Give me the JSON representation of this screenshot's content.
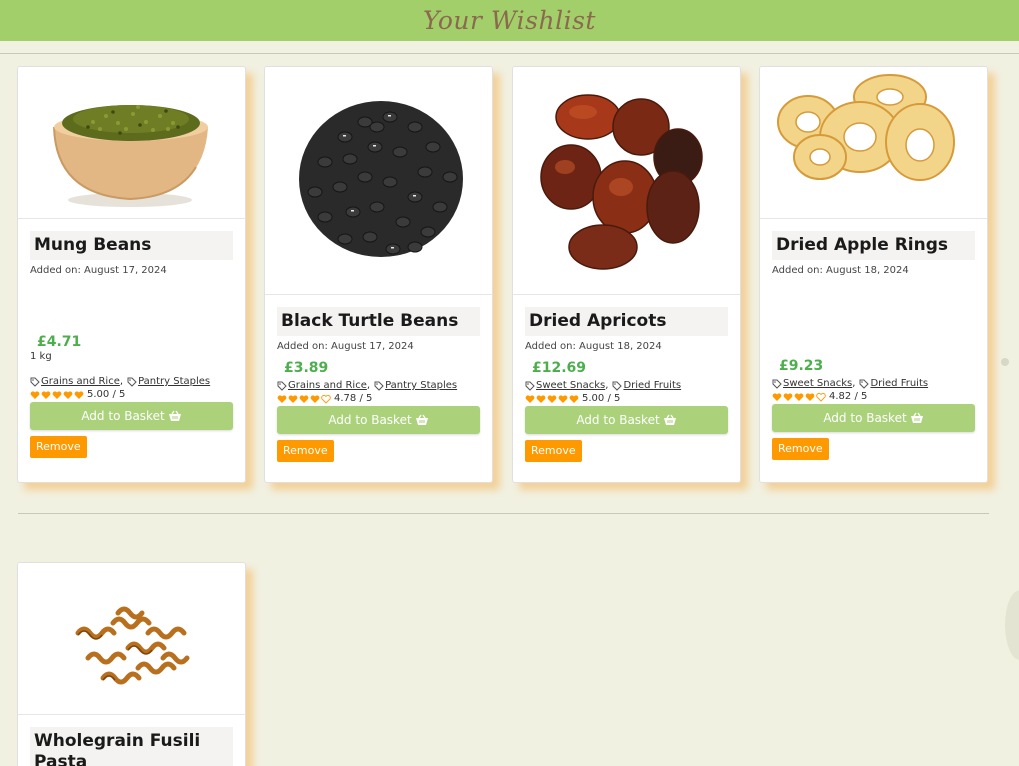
{
  "header": {
    "title": "Your Wishlist"
  },
  "colors": {
    "header_bg": "#a3cf6a",
    "price": "#4caf4c",
    "basket_button": "#abd27b",
    "remove_button": "#ff9900",
    "heart": "#ff9900"
  },
  "products": [
    {
      "name": "Mung Beans",
      "added": "Added on: August 17, 2024",
      "price": "£4.71",
      "unit": "1 kg",
      "tags": [
        "Grains and Rice",
        "Pantry Staples"
      ],
      "tag_separator": ",",
      "rating_value": 5.0,
      "rating_text": "5.00 / 5",
      "basket_label": "Add to Basket",
      "remove_label": "Remove",
      "image": "mung-beans-in-wooden-bowl"
    },
    {
      "name": "Black Turtle Beans",
      "added": "Added on: August 17, 2024",
      "price": "£3.89",
      "unit": "",
      "tags": [
        "Grains and Rice",
        "Pantry Staples"
      ],
      "tag_separator": ",",
      "rating_value": 4.78,
      "rating_text": "4.78 / 5",
      "basket_label": "Add to Basket",
      "remove_label": "Remove",
      "image": "black-beans-pile"
    },
    {
      "name": "Dried Apricots",
      "added": "Added on: August 18, 2024",
      "price": "£12.69",
      "unit": "",
      "tags": [
        "Sweet Snacks",
        "Dried Fruits"
      ],
      "tag_separator": ",",
      "rating_value": 5.0,
      "rating_text": "5.00 / 5",
      "basket_label": "Add to Basket",
      "remove_label": "Remove",
      "image": "dried-apricots-pile"
    },
    {
      "name": "Dried Apple Rings",
      "added": "Added on: August 18, 2024",
      "price": "£9.23",
      "unit": "",
      "tags": [
        "Sweet Snacks",
        "Dried Fruits"
      ],
      "tag_separator": ",",
      "rating_value": 4.82,
      "rating_text": "4.82 / 5",
      "basket_label": "Add to Basket",
      "remove_label": "Remove",
      "image": "dried-apple-rings"
    },
    {
      "name": "Wholegrain Fusili Pasta",
      "image": "fusilli-pasta-pile"
    }
  ]
}
